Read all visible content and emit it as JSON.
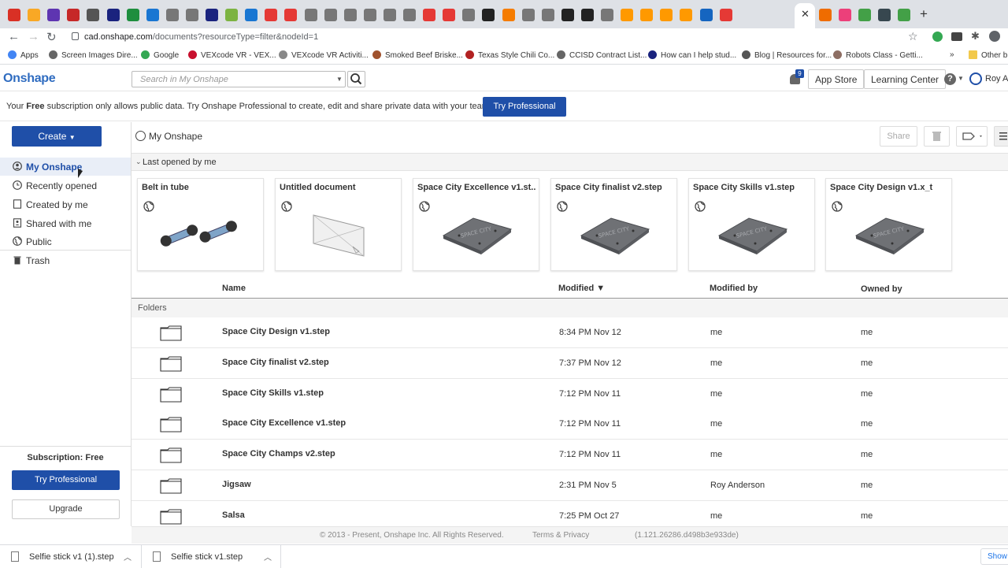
{
  "browser": {
    "tab_close": "✕",
    "new_tab": "+",
    "url_host": "cad.onshape.com",
    "url_path": "/documents?resourceType=filter&nodeId=1",
    "bookmarks": [
      {
        "label": "Apps",
        "color": "#4285f4"
      },
      {
        "label": "Screen Images Dire...",
        "color": "#666666"
      },
      {
        "label": "Google",
        "color": "#34a853"
      },
      {
        "label": "VEXcode VR - VEX...",
        "color": "#c8102e"
      },
      {
        "label": "VEXcode VR Activiti...",
        "color": "#888888"
      },
      {
        "label": "Smoked Beef Briske...",
        "color": "#a0522d"
      },
      {
        "label": "Texas Style Chili Co...",
        "color": "#b22222"
      },
      {
        "label": "CCISD Contract List...",
        "color": "#666666"
      },
      {
        "label": "How can I help stud...",
        "color": "#1a237e"
      },
      {
        "label": "Blog | Resources for...",
        "color": "#555555"
      },
      {
        "label": "Robots Class - Getti...",
        "color": "#8d6e63"
      }
    ],
    "bookmarks_more": "»",
    "other_bookmarks": "Other b"
  },
  "header": {
    "logo": "Onshape",
    "search_placeholder": "Search in My Onshape",
    "notification_count": "9",
    "app_store": "App Store",
    "learning_center": "Learning Center",
    "help_icon": "?",
    "user": "Roy An"
  },
  "promo": {
    "text_before": "Your ",
    "text_bold": "Free",
    "text_after": " subscription only allows public data. Try Onshape Professional to create, edit and share private data with your team.",
    "button": "Try Professional"
  },
  "sidebar": {
    "create": "Create",
    "items": [
      {
        "label": "My Onshape",
        "icon": "user-circle-icon",
        "selected": true
      },
      {
        "label": "Recently opened",
        "icon": "clock-icon",
        "selected": false
      },
      {
        "label": "Created by me",
        "icon": "document-icon",
        "selected": false
      },
      {
        "label": "Shared with me",
        "icon": "shared-icon",
        "selected": false
      },
      {
        "label": "Public",
        "icon": "globe-icon",
        "selected": false
      },
      {
        "label": "Trash",
        "icon": "trash-icon",
        "selected": false
      }
    ],
    "subscription": "Subscription: Free",
    "try_pro": "Try Professional",
    "upgrade": "Upgrade"
  },
  "main": {
    "breadcrumb": "My Onshape",
    "share": "Share",
    "recent_header": "Last opened by me",
    "recent_cards": [
      {
        "title": "Belt in tube",
        "thumb": "belt"
      },
      {
        "title": "Untitled document",
        "thumb": "plane"
      },
      {
        "title": "Space City Excellence v1.st...",
        "thumb": "plate"
      },
      {
        "title": "Space City finalist v2.step",
        "thumb": "plate"
      },
      {
        "title": "Space City Skills v1.step",
        "thumb": "plate"
      },
      {
        "title": "Space City Design v1.x_t",
        "thumb": "plate"
      }
    ],
    "columns": {
      "name": "Name",
      "modified": "Modified ▼",
      "modified_by": "Modified by",
      "owned_by": "Owned by"
    },
    "folders_label": "Folders",
    "rows": [
      {
        "name": "Space City Design v1.step",
        "modified": "8:34 PM Nov 12",
        "modified_by": "me",
        "owned_by": "me"
      },
      {
        "name": "Space City finalist v2.step",
        "modified": "7:37 PM Nov 12",
        "modified_by": "me",
        "owned_by": "me"
      },
      {
        "name": "Space City Skills v1.step",
        "modified": "7:12 PM Nov 11",
        "modified_by": "me",
        "owned_by": "me"
      },
      {
        "name": "Space City Excellence v1.step",
        "modified": "7:12 PM Nov 11",
        "modified_by": "me",
        "owned_by": "me"
      },
      {
        "name": "Space City Champs v2.step",
        "modified": "7:12 PM Nov 11",
        "modified_by": "me",
        "owned_by": "me"
      },
      {
        "name": "Jigsaw",
        "modified": "2:31 PM Nov 5",
        "modified_by": "Roy Anderson",
        "owned_by": "me"
      },
      {
        "name": "Salsa",
        "modified": "7:25 PM Oct 27",
        "modified_by": "me",
        "owned_by": "me"
      }
    ]
  },
  "footer": {
    "copyright": "© 2013 - Present, Onshape Inc. All Rights Reserved.",
    "terms": "Terms & Privacy",
    "version": "(1.121.26286.d498b3e933de)"
  },
  "downloads": {
    "files": [
      "Selfie stick v1 (1).step",
      "Selfie stick v1.step"
    ],
    "show_all": "Show"
  },
  "colors": {
    "accent": "#1f4fa8",
    "logo": "#2f6cc0"
  }
}
